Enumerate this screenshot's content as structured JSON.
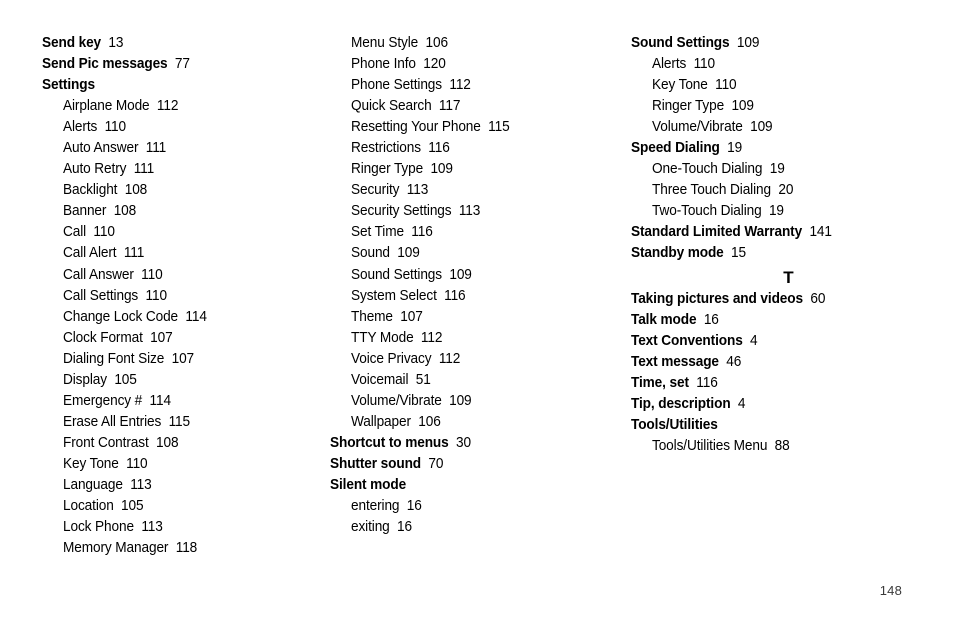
{
  "document": {
    "type": "index",
    "folio": "148"
  },
  "columns": [
    {
      "id": "column-1",
      "entries": [
        {
          "label": "Send key",
          "page": "13",
          "level": 0
        },
        {
          "label": "Send Pic messages",
          "page": "77",
          "level": 0
        },
        {
          "label": "Settings",
          "page": "",
          "level": 0
        },
        {
          "label": "Airplane Mode",
          "page": "112",
          "level": 1
        },
        {
          "label": "Alerts",
          "page": "110",
          "level": 1
        },
        {
          "label": "Auto Answer",
          "page": "111",
          "level": 1
        },
        {
          "label": "Auto Retry",
          "page": "111",
          "level": 1
        },
        {
          "label": "Backlight",
          "page": "108",
          "level": 1
        },
        {
          "label": "Banner",
          "page": "108",
          "level": 1
        },
        {
          "label": "Call",
          "page": "110",
          "level": 1
        },
        {
          "label": "Call Alert",
          "page": "111",
          "level": 1
        },
        {
          "label": "Call Answer",
          "page": "110",
          "level": 1
        },
        {
          "label": "Call Settings",
          "page": "110",
          "level": 1
        },
        {
          "label": "Change Lock Code",
          "page": "114",
          "level": 1
        },
        {
          "label": "Clock Format",
          "page": "107",
          "level": 1
        },
        {
          "label": "Dialing Font Size",
          "page": "107",
          "level": 1
        },
        {
          "label": "Display",
          "page": "105",
          "level": 1
        },
        {
          "label": "Emergency #",
          "page": "114",
          "level": 1
        },
        {
          "label": "Erase All Entries",
          "page": "115",
          "level": 1
        },
        {
          "label": "Front Contrast",
          "page": "108",
          "level": 1
        },
        {
          "label": "Key Tone",
          "page": "110",
          "level": 1
        },
        {
          "label": "Language",
          "page": "113",
          "level": 1
        },
        {
          "label": "Location",
          "page": "105",
          "level": 1
        },
        {
          "label": "Lock Phone",
          "page": "113",
          "level": 1
        },
        {
          "label": "Memory Manager",
          "page": "118",
          "level": 1
        }
      ]
    },
    {
      "id": "column-2",
      "entries": [
        {
          "label": "Menu Style",
          "page": "106",
          "level": 1
        },
        {
          "label": "Phone Info",
          "page": "120",
          "level": 1
        },
        {
          "label": "Phone Settings",
          "page": "112",
          "level": 1
        },
        {
          "label": "Quick Search",
          "page": "117",
          "level": 1
        },
        {
          "label": "Resetting Your Phone",
          "page": "115",
          "level": 1
        },
        {
          "label": "Restrictions",
          "page": "116",
          "level": 1
        },
        {
          "label": "Ringer Type",
          "page": "109",
          "level": 1
        },
        {
          "label": "Security",
          "page": "113",
          "level": 1
        },
        {
          "label": "Security Settings",
          "page": "113",
          "level": 1
        },
        {
          "label": "Set Time",
          "page": "116",
          "level": 1
        },
        {
          "label": "Sound",
          "page": "109",
          "level": 1
        },
        {
          "label": "Sound Settings",
          "page": "109",
          "level": 1
        },
        {
          "label": "System Select",
          "page": "116",
          "level": 1
        },
        {
          "label": "Theme",
          "page": "107",
          "level": 1
        },
        {
          "label": "TTY Mode",
          "page": "112",
          "level": 1
        },
        {
          "label": "Voice Privacy",
          "page": "112",
          "level": 1
        },
        {
          "label": "Voicemail",
          "page": "51",
          "level": 1
        },
        {
          "label": "Volume/Vibrate",
          "page": "109",
          "level": 1
        },
        {
          "label": "Wallpaper",
          "page": "106",
          "level": 1
        },
        {
          "label": "Shortcut to menus",
          "page": "30",
          "level": 0
        },
        {
          "label": "Shutter sound",
          "page": "70",
          "level": 0
        },
        {
          "label": "Silent mode",
          "page": "",
          "level": 0
        },
        {
          "label": "entering",
          "page": "16",
          "level": 1
        },
        {
          "label": "exiting",
          "page": "16",
          "level": 1
        }
      ]
    },
    {
      "id": "column-3",
      "entries": [
        {
          "label": "Sound Settings",
          "page": "109",
          "level": 0
        },
        {
          "label": "Alerts",
          "page": "110",
          "level": 1
        },
        {
          "label": "Key Tone",
          "page": "110",
          "level": 1
        },
        {
          "label": "Ringer Type",
          "page": "109",
          "level": 1
        },
        {
          "label": "Volume/Vibrate",
          "page": "109",
          "level": 1
        },
        {
          "label": "Speed Dialing",
          "page": "19",
          "level": 0
        },
        {
          "label": "One-Touch Dialing",
          "page": "19",
          "level": 1
        },
        {
          "label": "Three Touch Dialing",
          "page": "20",
          "level": 1
        },
        {
          "label": "Two-Touch Dialing",
          "page": "19",
          "level": 1
        },
        {
          "label": "Standard Limited Warranty",
          "page": "141",
          "level": 0
        },
        {
          "label": "Standby mode",
          "page": "15",
          "level": 0
        },
        {
          "letter": "T"
        },
        {
          "label": "Taking pictures and videos",
          "page": "60",
          "level": 0
        },
        {
          "label": "Talk mode",
          "page": "16",
          "level": 0
        },
        {
          "label": "Text Conventions",
          "page": "4",
          "level": 0
        },
        {
          "label": "Text message",
          "page": "46",
          "level": 0
        },
        {
          "label": "Time, set",
          "page": "116",
          "level": 0
        },
        {
          "label": "Tip, description",
          "page": "4",
          "level": 0
        },
        {
          "label": "Tools/Utilities",
          "page": "",
          "level": 0
        },
        {
          "label": "Tools/Utilities Menu",
          "page": "88",
          "level": 1
        }
      ]
    }
  ]
}
